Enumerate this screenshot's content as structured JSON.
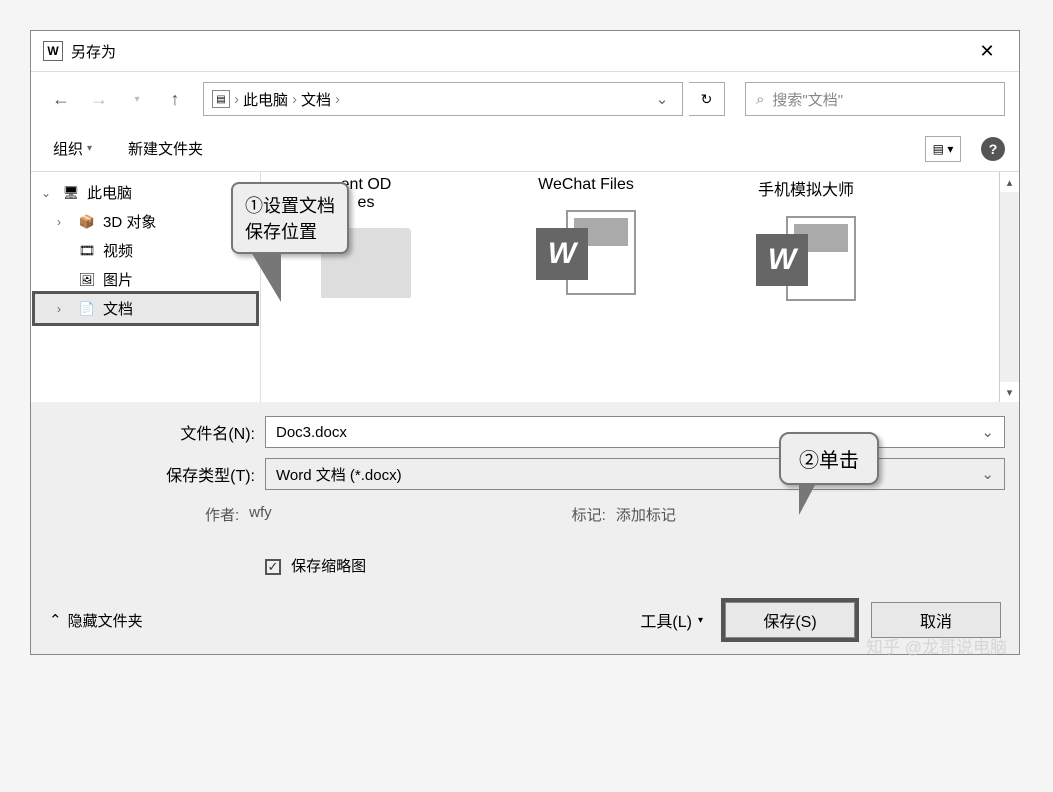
{
  "titlebar": {
    "app_letter": "W",
    "title": "另存为"
  },
  "nav": {
    "breadcrumb": [
      "此电脑",
      "文档"
    ],
    "search_placeholder": "搜索\"文档\""
  },
  "toolbar": {
    "organize": "组织",
    "new_folder": "新建文件夹"
  },
  "tree": {
    "items": [
      {
        "label": "此电脑",
        "icon": "🖥",
        "expanded": true,
        "level": 0
      },
      {
        "label": "3D 对象",
        "icon": "📦",
        "level": 1
      },
      {
        "label": "视频",
        "icon": "🎞",
        "level": 1
      },
      {
        "label": "图片",
        "icon": "🖼",
        "level": 1
      },
      {
        "label": "文档",
        "icon": "📄",
        "level": 1,
        "selected": true
      }
    ]
  },
  "files": [
    {
      "label_line1": "ent OD",
      "label_line2": "es",
      "type": "folder"
    },
    {
      "label": "WeChat Files",
      "type": "folder"
    },
    {
      "label": "手机模拟大师",
      "type": "folder"
    }
  ],
  "word_items": [
    {
      "type": "word"
    },
    {
      "type": "word"
    }
  ],
  "form": {
    "filename_label": "文件名(N):",
    "filename_value": "Doc3.docx",
    "filetype_label": "保存类型(T):",
    "filetype_value": "Word 文档 (*.docx)",
    "author_label": "作者:",
    "author_value": "wfy",
    "tags_label": "标记:",
    "tags_value": "添加标记",
    "thumbnail_check": "保存缩略图"
  },
  "actions": {
    "hide_folders": "隐藏文件夹",
    "tools": "工具(L)",
    "save": "保存(S)",
    "cancel": "取消"
  },
  "callouts": {
    "c1_line1": "①设置文档",
    "c1_line2": "保存位置",
    "c2": "②单击"
  },
  "watermark": "知乎 @龙哥说电脑"
}
